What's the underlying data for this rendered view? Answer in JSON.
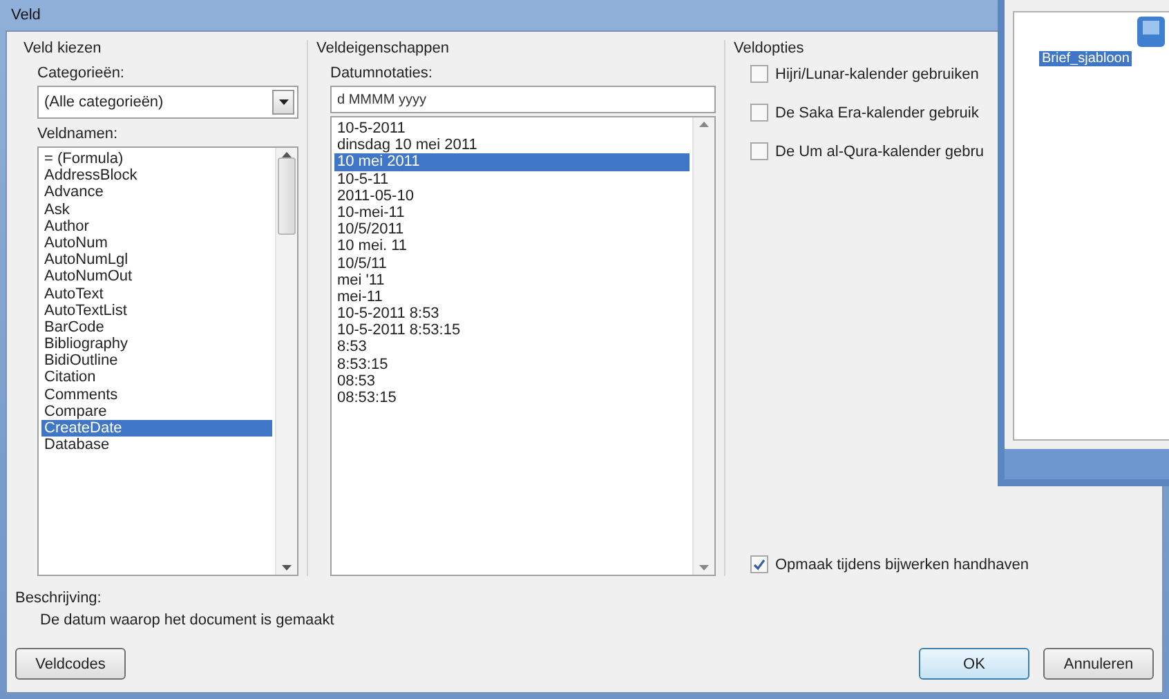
{
  "window": {
    "title": "Veld"
  },
  "choose_field": {
    "heading": "Veld kiezen",
    "categories_label": "Categorieën:",
    "category_value": "(Alle categorieën)",
    "names_label": "Veldnamen:",
    "field_names": [
      {
        "label": "= (Formula)",
        "selected": false
      },
      {
        "label": "AddressBlock",
        "selected": false
      },
      {
        "label": "Advance",
        "selected": false
      },
      {
        "label": "Ask",
        "selected": false
      },
      {
        "label": "Author",
        "selected": false
      },
      {
        "label": "AutoNum",
        "selected": false
      },
      {
        "label": "AutoNumLgl",
        "selected": false
      },
      {
        "label": "AutoNumOut",
        "selected": false
      },
      {
        "label": "AutoText",
        "selected": false
      },
      {
        "label": "AutoTextList",
        "selected": false
      },
      {
        "label": "BarCode",
        "selected": false
      },
      {
        "label": "Bibliography",
        "selected": false
      },
      {
        "label": "BidiOutline",
        "selected": false
      },
      {
        "label": "Citation",
        "selected": false
      },
      {
        "label": "Comments",
        "selected": false
      },
      {
        "label": "Compare",
        "selected": false
      },
      {
        "label": "CreateDate",
        "selected": true
      },
      {
        "label": "Database",
        "selected": false
      }
    ]
  },
  "field_properties": {
    "heading": "Veldeigenschappen",
    "formats_label": "Datumnotaties:",
    "format_value": "d MMMM yyyy",
    "formats": [
      {
        "label": "10-5-2011",
        "selected": false
      },
      {
        "label": "dinsdag 10 mei 2011",
        "selected": false
      },
      {
        "label": "10 mei 2011",
        "selected": true
      },
      {
        "label": "10-5-11",
        "selected": false
      },
      {
        "label": "2011-05-10",
        "selected": false
      },
      {
        "label": "10-mei-11",
        "selected": false
      },
      {
        "label": "10/5/2011",
        "selected": false
      },
      {
        "label": "10 mei. 11",
        "selected": false
      },
      {
        "label": "10/5/11",
        "selected": false
      },
      {
        "label": "mei '11",
        "selected": false
      },
      {
        "label": "mei-11",
        "selected": false
      },
      {
        "label": "10-5-2011 8:53",
        "selected": false
      },
      {
        "label": "10-5-2011 8:53:15",
        "selected": false
      },
      {
        "label": "8:53",
        "selected": false
      },
      {
        "label": "8:53:15",
        "selected": false
      },
      {
        "label": "08:53",
        "selected": false
      },
      {
        "label": "08:53:15",
        "selected": false
      }
    ]
  },
  "field_options": {
    "heading": "Veldopties",
    "options": [
      {
        "label": "Hijri/Lunar-kalender gebruiken",
        "checked": false
      },
      {
        "label": "De Saka Era-kalender gebruik",
        "checked": false
      },
      {
        "label": "De Um al-Qura-kalender gebru",
        "checked": false
      }
    ],
    "preserve": {
      "label": "Opmaak tijdens bijwerken handhaven",
      "checked": true
    }
  },
  "description": {
    "label": "Beschrijving:",
    "text": "De datum waarop het document is gemaakt"
  },
  "buttons": {
    "field_codes": "Veldcodes",
    "ok": "OK",
    "cancel": "Annuleren"
  },
  "background_window": {
    "file_label": "Brief_sjabloon"
  }
}
